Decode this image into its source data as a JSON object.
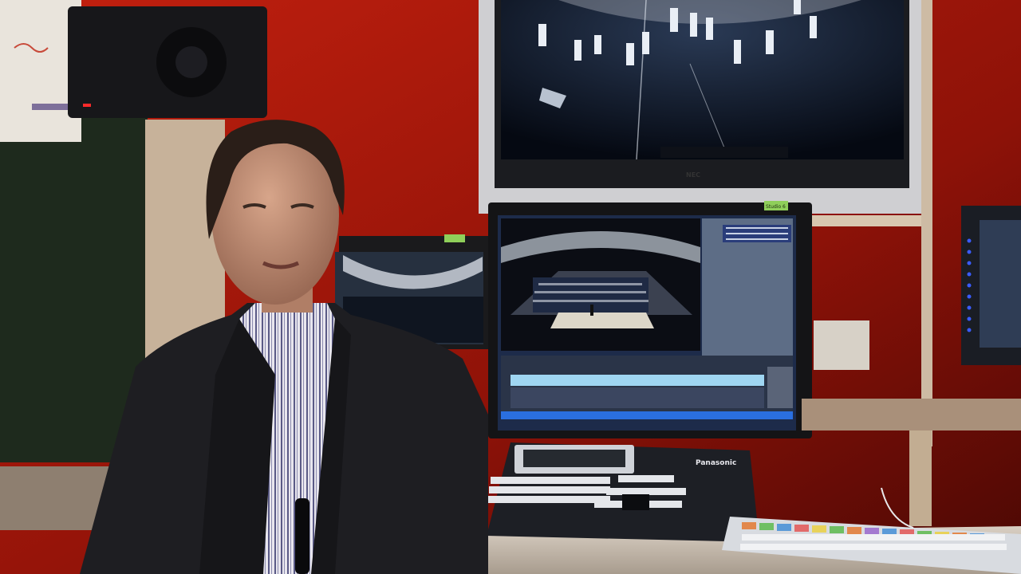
{
  "scene": {
    "kind": "video-frame",
    "setting": "broadcast-control-room"
  },
  "labels": {
    "monitor_brand": "NEC",
    "switcher_brand": "Panasonic",
    "sticky_note": "Studio 6"
  },
  "colors": {
    "wall_red": "#b51a10",
    "timeline_blue": "#9fd6f2",
    "led_blue": "#3a5cff",
    "keyboard_orange": "#e2884c",
    "keyboard_green": "#6fbf63"
  }
}
